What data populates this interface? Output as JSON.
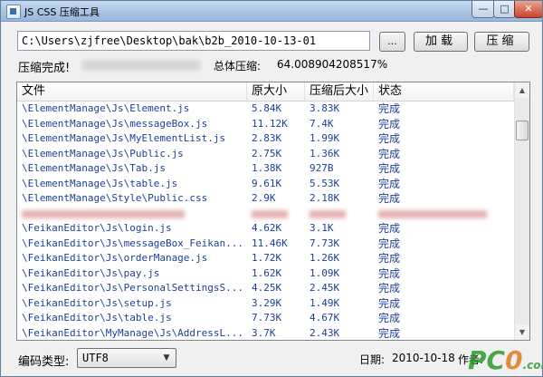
{
  "window": {
    "title": "JS CSS 压缩工具"
  },
  "toolbar": {
    "path_value": "C:\\Users\\zjfree\\Desktop\\bak\\b2b_2010-10-13-01",
    "browse_label": "...",
    "load_label": "加载",
    "compress_label": "压缩"
  },
  "status": {
    "label": "压缩完成!",
    "total_label": "总体压缩:",
    "total_value": "64.008904208517%"
  },
  "table": {
    "columns": [
      "文件",
      "原大小",
      "压缩后大小",
      "状态"
    ],
    "rows": [
      {
        "file": "\\ElementManage\\Js\\Element.js",
        "orig": "5.84K",
        "comp": "3.83K",
        "status": "完成"
      },
      {
        "file": "\\ElementManage\\Js\\messageBox.js",
        "orig": "11.12K",
        "comp": "7.4K",
        "status": "完成"
      },
      {
        "file": "\\ElementManage\\Js\\MyElementList.js",
        "orig": "2.83K",
        "comp": "1.99K",
        "status": "完成"
      },
      {
        "file": "\\ElementManage\\Js\\Public.js",
        "orig": "2.75K",
        "comp": "1.36K",
        "status": "完成"
      },
      {
        "file": "\\ElementManage\\Js\\Tab.js",
        "orig": "1.38K",
        "comp": "927B",
        "status": "完成"
      },
      {
        "file": "\\ElementManage\\Js\\table.js",
        "orig": "9.61K",
        "comp": "5.53K",
        "status": "完成"
      },
      {
        "file": "\\ElementManage\\Style\\Public.css",
        "orig": "2.9K",
        "comp": "2.18K",
        "status": "完成"
      },
      {
        "file": "",
        "orig": "",
        "comp": "",
        "status": "",
        "blurred": true
      },
      {
        "file": "\\FeikanEditor\\Js\\login.js",
        "orig": "4.62K",
        "comp": "3.1K",
        "status": "完成"
      },
      {
        "file": "\\FeikanEditor\\Js\\messageBox_Feikan...",
        "orig": "11.46K",
        "comp": "7.73K",
        "status": "完成"
      },
      {
        "file": "\\FeikanEditor\\Js\\orderManage.js",
        "orig": "1.72K",
        "comp": "1.26K",
        "status": "完成"
      },
      {
        "file": "\\FeikanEditor\\Js\\pay.js",
        "orig": "1.62K",
        "comp": "1.09K",
        "status": "完成"
      },
      {
        "file": "\\FeikanEditor\\Js\\PersonalSettingsS...",
        "orig": "4.25K",
        "comp": "2.45K",
        "status": "完成"
      },
      {
        "file": "\\FeikanEditor\\Js\\setup.js",
        "orig": "3.29K",
        "comp": "1.49K",
        "status": "完成"
      },
      {
        "file": "\\FeikanEditor\\Js\\table.js",
        "orig": "7.73K",
        "comp": "4.67K",
        "status": "完成"
      },
      {
        "file": "\\FeikanEditor\\MyManage\\Js\\AddressL...",
        "orig": "3.7K",
        "comp": "2.43K",
        "status": "完成"
      }
    ]
  },
  "footer": {
    "encoding_label": "编码类型:",
    "encoding_value": "UTF8",
    "date_label": "日期:",
    "date_value": "2010-10-18",
    "author_label": "作者:"
  },
  "watermark": {
    "text_a": "PC",
    "text_b": "0",
    "text_c": ".com"
  }
}
